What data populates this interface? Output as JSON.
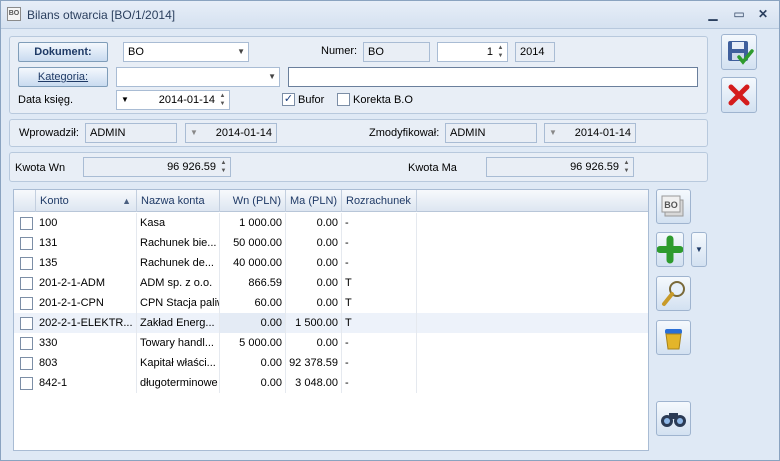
{
  "window": {
    "title": "Bilans otwarcia [BO/1/2014]",
    "icon": "BO"
  },
  "form": {
    "dokument_btn": "Dokument:",
    "dokument_val": "BO",
    "numer_lbl": "Numer:",
    "numer_prefix": "BO",
    "numer_no": "1",
    "numer_year": "2014",
    "kategoria_btn": "Kategoria:",
    "kategoria_val": "",
    "kategoria_desc": "",
    "data_lbl": "Data księg.",
    "data_val": "2014-01-14",
    "bufor_lbl": "Bufor",
    "bufor_checked": true,
    "korekta_lbl": "Korekta B.O",
    "korekta_checked": false
  },
  "audit": {
    "wprowadzil_lbl": "Wprowadził:",
    "wprowadzil_user": "ADMIN",
    "wprowadzil_date": "2014-01-14",
    "zmodyfikowal_lbl": "Zmodyfikował:",
    "zmodyfikowal_user": "ADMIN",
    "zmodyfikowal_date": "2014-01-14"
  },
  "totals": {
    "wn_lbl": "Kwota Wn",
    "wn_val": "96 926.59",
    "ma_lbl": "Kwota Ma",
    "ma_val": "96 926.59"
  },
  "grid": {
    "headers": {
      "konto": "Konto",
      "nazwa": "Nazwa konta",
      "wn": "Wn (PLN)",
      "ma": "Ma (PLN)",
      "rozr": "Rozrachunek"
    },
    "rows": [
      {
        "konto": "100",
        "nazwa": "Kasa",
        "wn": "1 000.00",
        "ma": "0.00",
        "rozr": "-"
      },
      {
        "konto": "131",
        "nazwa": "Rachunek bie...",
        "wn": "50 000.00",
        "ma": "0.00",
        "rozr": "-"
      },
      {
        "konto": "135",
        "nazwa": "Rachunek de...",
        "wn": "40 000.00",
        "ma": "0.00",
        "rozr": "-"
      },
      {
        "konto": "201-2-1-ADM",
        "nazwa": "ADM sp. z o.o.",
        "wn": "866.59",
        "ma": "0.00",
        "rozr": "T"
      },
      {
        "konto": "201-2-1-CPN",
        "nazwa": "CPN Stacja paliw",
        "wn": "60.00",
        "ma": "0.00",
        "rozr": "T"
      },
      {
        "konto": "202-2-1-ELEKTR...",
        "nazwa": "Zakład Energ...",
        "wn": "0.00",
        "ma": "1 500.00",
        "rozr": "T"
      },
      {
        "konto": "330",
        "nazwa": "Towary handl...",
        "wn": "5 000.00",
        "ma": "0.00",
        "rozr": "-"
      },
      {
        "konto": "803",
        "nazwa": "Kapitał właści...",
        "wn": "0.00",
        "ma": "92 378.59",
        "rozr": "-"
      },
      {
        "konto": "842-1",
        "nazwa": "długoterminowe",
        "wn": "0.00",
        "ma": "3 048.00",
        "rozr": "-"
      }
    ]
  },
  "side": {
    "bo_text": "BO"
  },
  "colors": {
    "accent": "#1f3a66",
    "save_green": "#2e9b2e",
    "cancel_red": "#d41c1c",
    "trash_blue": "#2a6fd6"
  }
}
